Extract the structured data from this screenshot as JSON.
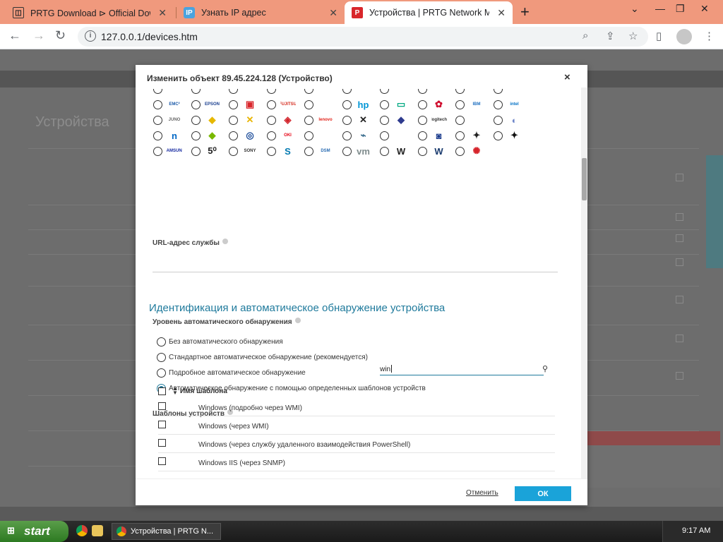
{
  "browser": {
    "tabs": [
      {
        "title": "PRTG Download ⊳ Official Down"
      },
      {
        "title": "Узнать IP адрес"
      },
      {
        "title": "Устройства | PRTG Network Mon"
      }
    ],
    "url": "127.0.0.1/devices.htm"
  },
  "modal": {
    "title": "Изменить объект 89.45.224.128 (Устройство)",
    "close_glyph": "×",
    "service_url_label": "URL-адрес службы",
    "section_title": "Идентификация и автоматическое обнаружение устройства",
    "discovery_label": "Уровень автоматического обнаружения",
    "discovery_options": [
      {
        "label": "Без автоматического обнаружения",
        "checked": false
      },
      {
        "label": "Стандартное автоматическое обнаружение (рекомендуется)",
        "checked": false
      },
      {
        "label": "Подробное автоматическое обнаружение",
        "checked": false
      },
      {
        "label": "Автоматическое обнаружение с помощью определенных шаблонов устройств",
        "checked": true
      }
    ],
    "templates_label": "Шаблоны устройств",
    "search_value": "win",
    "table_header": "Имя шаблона",
    "templates": [
      {
        "name": "Windows (подробно через WMI)",
        "checked": false
      },
      {
        "name": "Windows (через WMI)",
        "checked": false
      },
      {
        "name": "Windows (через службу удаленного взаимодействия PowerShell)",
        "checked": false
      },
      {
        "name": "Windows IIS (через SNMP)",
        "checked": false
      }
    ],
    "cancel_label": "Отменить",
    "ok_label": "ОК",
    "vendor_icons": [
      {
        "text": "EMC²",
        "color": "#1b5aa8"
      },
      {
        "text": "EPSON",
        "color": "#1a3f8f"
      },
      {
        "text": "▣",
        "color": "#d9262b"
      },
      {
        "text": "FUJITSU",
        "color": "#d52b1e"
      },
      {
        "text": "",
        "color": "#c8102e"
      },
      {
        "text": "hp",
        "color": "#0096d6"
      },
      {
        "text": "▭",
        "color": "#01a982"
      },
      {
        "text": "✿",
        "color": "#cf0a2c"
      },
      {
        "text": "IBM",
        "color": "#1f70c1"
      },
      {
        "text": "intel",
        "color": "#0071c5"
      },
      {
        "text": "JUNO",
        "color": "#666666"
      },
      {
        "text": "◆",
        "color": "#e6b800"
      },
      {
        "text": "✕",
        "color": "#e8b400"
      },
      {
        "text": "◈",
        "color": "#d2232a"
      },
      {
        "text": "lenovo",
        "color": "#e2231a"
      },
      {
        "text": "✕",
        "color": "#222222"
      },
      {
        "text": "◆",
        "color": "#2e3b8e"
      },
      {
        "text": "logitech",
        "color": "#333333"
      },
      {
        "text": "",
        "color": "#222222"
      },
      {
        "text": "◐",
        "color": "#6f86c9"
      },
      {
        "text": "n",
        "color": "#0067c5"
      },
      {
        "text": "◆",
        "color": "#79b800"
      },
      {
        "text": "◎",
        "color": "#1c4c9a"
      },
      {
        "text": "OKI",
        "color": "#e60012"
      },
      {
        "text": "",
        "color": "#c8102e"
      },
      {
        "text": "⌁",
        "color": "#3c6e8f"
      },
      {
        "text": "",
        "color": "#555555"
      },
      {
        "text": "◙",
        "color": "#1a3b8c"
      },
      {
        "text": "✦",
        "color": "#222222"
      },
      {
        "text": "✦",
        "color": "#111111"
      },
      {
        "text": "SAMSUNG",
        "color": "#1428a0"
      },
      {
        "text": "5⁰",
        "color": "#222222"
      },
      {
        "text": "SONY",
        "color": "#333333"
      },
      {
        "text": "S",
        "color": "#0078b0"
      },
      {
        "text": "DSM",
        "color": "#2b6db3"
      },
      {
        "text": "vm",
        "color": "#7f8c8d"
      },
      {
        "text": "W",
        "color": "#222222"
      },
      {
        "text": "W",
        "color": "#1a3b6e"
      },
      {
        "text": "✺",
        "color": "#d6242b"
      }
    ]
  },
  "taskbar": {
    "start_label": "start",
    "task_title": "Устройства | PRTG N...",
    "clock": "9:17 AM"
  },
  "background_page": {
    "title": "Устройства"
  }
}
